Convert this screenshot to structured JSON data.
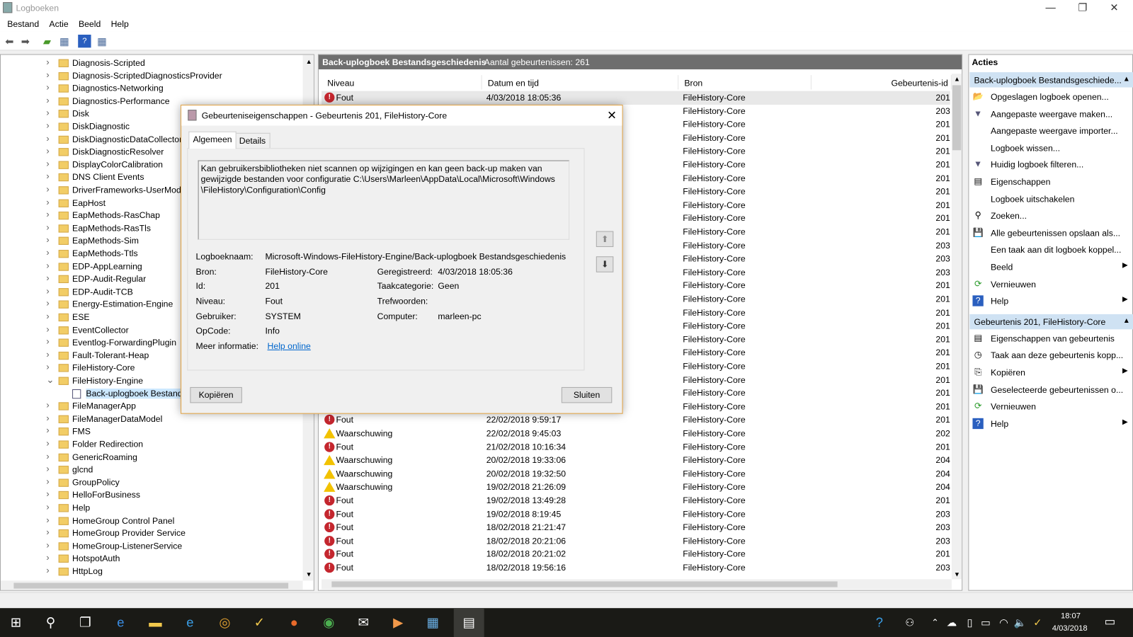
{
  "window": {
    "title": "Logboeken",
    "minimize": "—",
    "restore": "❐",
    "close": "✕"
  },
  "menu": [
    "Bestand",
    "Actie",
    "Beeld",
    "Help"
  ],
  "tree": {
    "items": [
      "Diagnosis-Scripted",
      "Diagnosis-ScriptedDiagnosticsProvider",
      "Diagnostics-Networking",
      "Diagnostics-Performance",
      "Disk",
      "DiskDiagnostic",
      "DiskDiagnosticDataCollector",
      "DiskDiagnosticResolver",
      "DisplayColorCalibration",
      "DNS Client Events",
      "DriverFrameworks-UserMode",
      "EapHost",
      "EapMethods-RasChap",
      "EapMethods-RasTls",
      "EapMethods-Sim",
      "EapMethods-Ttls",
      "EDP-AppLearning",
      "EDP-Audit-Regular",
      "EDP-Audit-TCB",
      "Energy-Estimation-Engine",
      "ESE",
      "EventCollector",
      "Eventlog-ForwardingPlugin",
      "Fault-Tolerant-Heap",
      "FileHistory-Core",
      "FileHistory-Engine",
      "Back-uplogboek Bestandsgeschiedenis",
      "FileManagerApp",
      "FileManagerDataModel",
      "FMS",
      "Folder Redirection",
      "GenericRoaming",
      "glcnd",
      "GroupPolicy",
      "HelloForBusiness",
      "Help",
      "HomeGroup Control Panel",
      "HomeGroup Provider Service",
      "HomeGroup-ListenerService",
      "HotspotAuth",
      "HttpLog"
    ],
    "expanded": "FileHistory-Engine",
    "selected": "Back-uplogboek Bestandsgeschiedenis"
  },
  "center": {
    "log_name": "Back-uplogboek Bestandsgeschiedenis",
    "count_label": "Aantal gebeurtenissen: 261",
    "columns": [
      "Niveau",
      "Datum en tijd",
      "Bron",
      "Gebeurtenis-id"
    ],
    "rows": [
      {
        "level": "Fout",
        "date": "4/03/2018 18:05:36",
        "source": "FileHistory-Core",
        "id": "201"
      },
      {
        "source": "FileHistory-Core",
        "id": "203"
      },
      {
        "source": "FileHistory-Core",
        "id": "201"
      },
      {
        "source": "FileHistory-Core",
        "id": "201"
      },
      {
        "source": "FileHistory-Core",
        "id": "201"
      },
      {
        "source": "FileHistory-Core",
        "id": "201"
      },
      {
        "source": "FileHistory-Core",
        "id": "201"
      },
      {
        "source": "FileHistory-Core",
        "id": "201"
      },
      {
        "source": "FileHistory-Core",
        "id": "201"
      },
      {
        "source": "FileHistory-Core",
        "id": "201"
      },
      {
        "source": "FileHistory-Core",
        "id": "201"
      },
      {
        "source": "FileHistory-Core",
        "id": "203"
      },
      {
        "source": "FileHistory-Core",
        "id": "203"
      },
      {
        "source": "FileHistory-Core",
        "id": "203"
      },
      {
        "source": "FileHistory-Core",
        "id": "201"
      },
      {
        "source": "FileHistory-Core",
        "id": "201"
      },
      {
        "source": "FileHistory-Core",
        "id": "201"
      },
      {
        "source": "FileHistory-Core",
        "id": "201"
      },
      {
        "source": "FileHistory-Core",
        "id": "201"
      },
      {
        "source": "FileHistory-Core",
        "id": "201"
      },
      {
        "source": "FileHistory-Core",
        "id": "201"
      },
      {
        "source": "FileHistory-Core",
        "id": "201"
      },
      {
        "source": "FileHistory-Core",
        "id": "201"
      },
      {
        "source": "FileHistory-Core",
        "id": "201"
      },
      {
        "level": "Fout",
        "date": "22/02/2018 9:59:17",
        "source": "FileHistory-Core",
        "id": "201"
      },
      {
        "level": "Waarschuwing",
        "date": "22/02/2018 9:45:03",
        "source": "FileHistory-Core",
        "id": "202"
      },
      {
        "level": "Fout",
        "date": "21/02/2018 10:16:34",
        "source": "FileHistory-Core",
        "id": "201"
      },
      {
        "level": "Waarschuwing",
        "date": "20/02/2018 19:33:06",
        "source": "FileHistory-Core",
        "id": "204"
      },
      {
        "level": "Waarschuwing",
        "date": "20/02/2018 19:32:50",
        "source": "FileHistory-Core",
        "id": "204"
      },
      {
        "level": "Waarschuwing",
        "date": "19/02/2018 21:26:09",
        "source": "FileHistory-Core",
        "id": "204"
      },
      {
        "level": "Fout",
        "date": "19/02/2018 13:49:28",
        "source": "FileHistory-Core",
        "id": "201"
      },
      {
        "level": "Fout",
        "date": "19/02/2018 8:19:45",
        "source": "FileHistory-Core",
        "id": "203"
      },
      {
        "level": "Fout",
        "date": "18/02/2018 21:21:47",
        "source": "FileHistory-Core",
        "id": "203"
      },
      {
        "level": "Fout",
        "date": "18/02/2018 20:21:06",
        "source": "FileHistory-Core",
        "id": "203"
      },
      {
        "level": "Fout",
        "date": "18/02/2018 20:21:02",
        "source": "FileHistory-Core",
        "id": "201"
      },
      {
        "level": "Fout",
        "date": "18/02/2018 19:56:16",
        "source": "FileHistory-Core",
        "id": "203"
      }
    ]
  },
  "actions": {
    "title": "Acties",
    "sections": [
      {
        "header": "Back-uplogboek Bestandsgeschiede...",
        "items": [
          {
            "label": "Opgeslagen logboek openen...",
            "icon": "folder-open-icon",
            "glyph": "📂"
          },
          {
            "label": "Aangepaste weergave maken...",
            "icon": "filter-icon",
            "glyph": "▼"
          },
          {
            "label": "Aangepaste weergave importer...",
            "icon": "",
            "glyph": ""
          },
          {
            "label": "Logboek wissen...",
            "icon": "",
            "glyph": ""
          },
          {
            "label": "Huidig logboek filteren...",
            "icon": "filter-icon",
            "glyph": "▼"
          },
          {
            "label": "Eigenschappen",
            "icon": "properties-icon",
            "glyph": "▤"
          },
          {
            "label": "Logboek uitschakelen",
            "icon": "",
            "glyph": ""
          },
          {
            "label": "Zoeken...",
            "icon": "binoculars-icon",
            "glyph": "⚲"
          },
          {
            "label": "Alle gebeurtenissen opslaan als...",
            "icon": "save-icon",
            "glyph": "💾"
          },
          {
            "label": "Een taak aan dit logboek koppel...",
            "icon": "",
            "glyph": ""
          },
          {
            "label": "Beeld",
            "icon": "",
            "glyph": "",
            "sub": true
          },
          {
            "label": "Vernieuwen",
            "icon": "refresh-icon",
            "glyph": "⟳"
          },
          {
            "label": "Help",
            "icon": "help-icon",
            "glyph": "?",
            "sub": true
          }
        ]
      },
      {
        "header": "Gebeurtenis 201, FileHistory-Core",
        "items": [
          {
            "label": "Eigenschappen van gebeurtenis",
            "icon": "properties-icon",
            "glyph": "▤"
          },
          {
            "label": "Taak aan deze gebeurtenis kopp...",
            "icon": "task-icon",
            "glyph": "◷"
          },
          {
            "label": "Kopiëren",
            "icon": "copy-icon",
            "glyph": "⎘",
            "sub": true
          },
          {
            "label": "Geselecteerde gebeurtenissen o...",
            "icon": "save-icon",
            "glyph": "💾"
          },
          {
            "label": "Vernieuwen",
            "icon": "refresh-icon",
            "glyph": "⟳"
          },
          {
            "label": "Help",
            "icon": "help-icon",
            "glyph": "?",
            "sub": true
          }
        ]
      }
    ]
  },
  "dialog": {
    "title": "Gebeurteniseigenschappen - Gebeurtenis 201, FileHistory-Core",
    "tabs": [
      "Algemeen",
      "Details"
    ],
    "active_tab": "Algemeen",
    "description": "Kan gebruikersbibliotheken niet scannen op wijzigingen en kan geen back-up maken van\ngewijzigde bestanden voor configuratie C:\\Users\\Marleen\\AppData\\Local\\Microsoft\\Windows\n\\FileHistory\\Configuration\\Config",
    "fields": {
      "logname_label": "Logboeknaam:",
      "logname": "Microsoft-Windows-FileHistory-Engine/Back-uplogboek Bestandsgeschiedenis",
      "source_label": "Bron:",
      "source": "FileHistory-Core",
      "logged_label": "Geregistreerd:",
      "logged": "4/03/2018 18:05:36",
      "id_label": "Id:",
      "id": "201",
      "category_label": "Taakcategorie:",
      "category": "Geen",
      "level_label": "Niveau:",
      "level": "Fout",
      "keywords_label": "Trefwoorden:",
      "user_label": "Gebruiker:",
      "user": "SYSTEM",
      "computer_label": "Computer:",
      "computer": "marleen-pc",
      "opcode_label": "OpCode:",
      "opcode": "Info",
      "more_label": "Meer informatie:",
      "more_link": "Help online"
    },
    "copy_button": "Kopiëren",
    "close_button": "Sluiten"
  },
  "taskbar": {
    "time": "18:07",
    "date": "4/03/2018"
  },
  "colors": {
    "header_bar": "#6e6e6e",
    "action_header": "#cfe2f3",
    "error": "#c4262e",
    "warning": "#f2c200",
    "taskbar": "#1a1a16"
  }
}
